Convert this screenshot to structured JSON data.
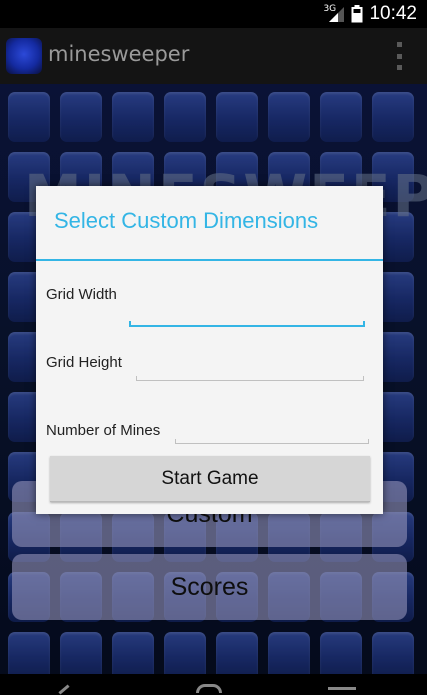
{
  "status_bar": {
    "network_label": "3G",
    "time": "10:42"
  },
  "action_bar": {
    "app_title": "minesweeper"
  },
  "background": {
    "game_title": "MINESWEEPER",
    "menu_buttons": [
      "Custom",
      "Scores"
    ]
  },
  "dialog": {
    "title": "Select Custom Dimensions",
    "fields": [
      {
        "label": "Grid Width",
        "value": "",
        "focused": true
      },
      {
        "label": "Grid Height",
        "value": "",
        "focused": false
      },
      {
        "label": "Number of Mines",
        "value": "",
        "focused": false
      }
    ],
    "start_button_label": "Start Game"
  },
  "colors": {
    "accent": "#33b5e5",
    "dialog_background": "#f4f4f4",
    "menu_button": "#aaaad7"
  },
  "icons": {
    "app": "minesweeper-app-icon",
    "overflow": "overflow-menu-icon",
    "signal": "cell-signal-icon",
    "battery": "battery-icon",
    "nav_back": "back-icon",
    "nav_home": "home-icon",
    "nav_recents": "recents-icon"
  }
}
